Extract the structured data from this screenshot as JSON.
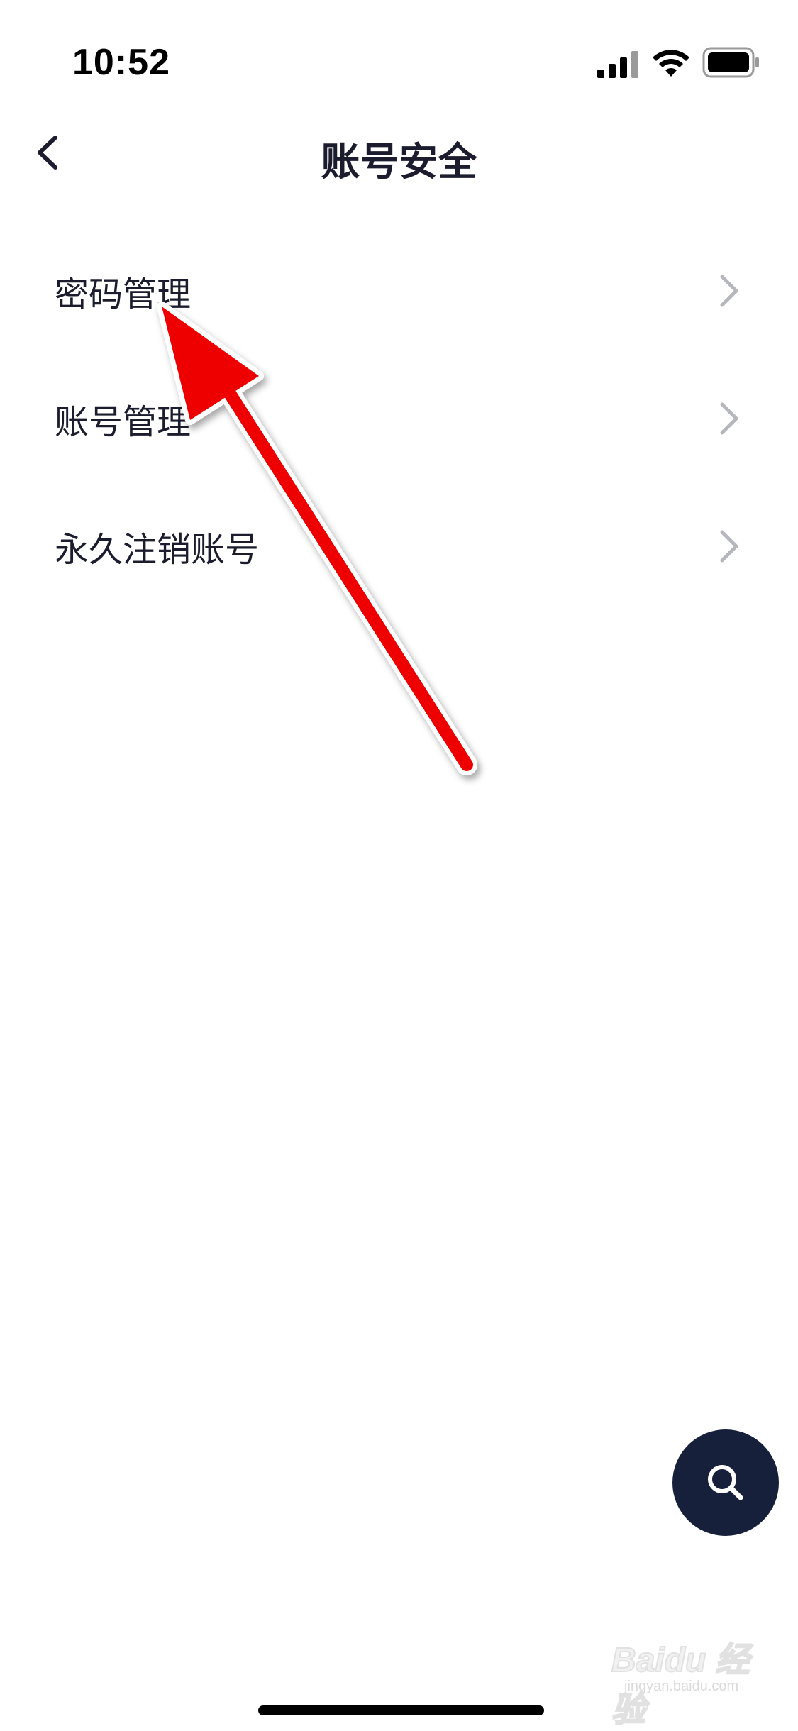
{
  "status_bar": {
    "time": "10:52",
    "icons": [
      "cellular-signal-icon",
      "wifi-icon",
      "battery-icon"
    ]
  },
  "nav": {
    "title": "账号安全",
    "back_icon": "chevron-left-icon"
  },
  "menu": {
    "items": [
      {
        "label": "密码管理",
        "icon": "chevron-right-icon"
      },
      {
        "label": "账号管理",
        "icon": "chevron-right-icon"
      },
      {
        "label": "永久注销账号",
        "icon": "chevron-right-icon"
      }
    ]
  },
  "fab": {
    "icon": "search-icon"
  },
  "watermark": {
    "brand": "Baidu 经验",
    "sub": "jingyan.baidu.com"
  },
  "annotation": {
    "icon": "red-arrow-annotation",
    "color": "#ee0000"
  },
  "colors": {
    "text": "#1b1d2e",
    "chevron": "#b5b7bd",
    "fab_bg": "#16203a",
    "background": "#ffffff"
  }
}
